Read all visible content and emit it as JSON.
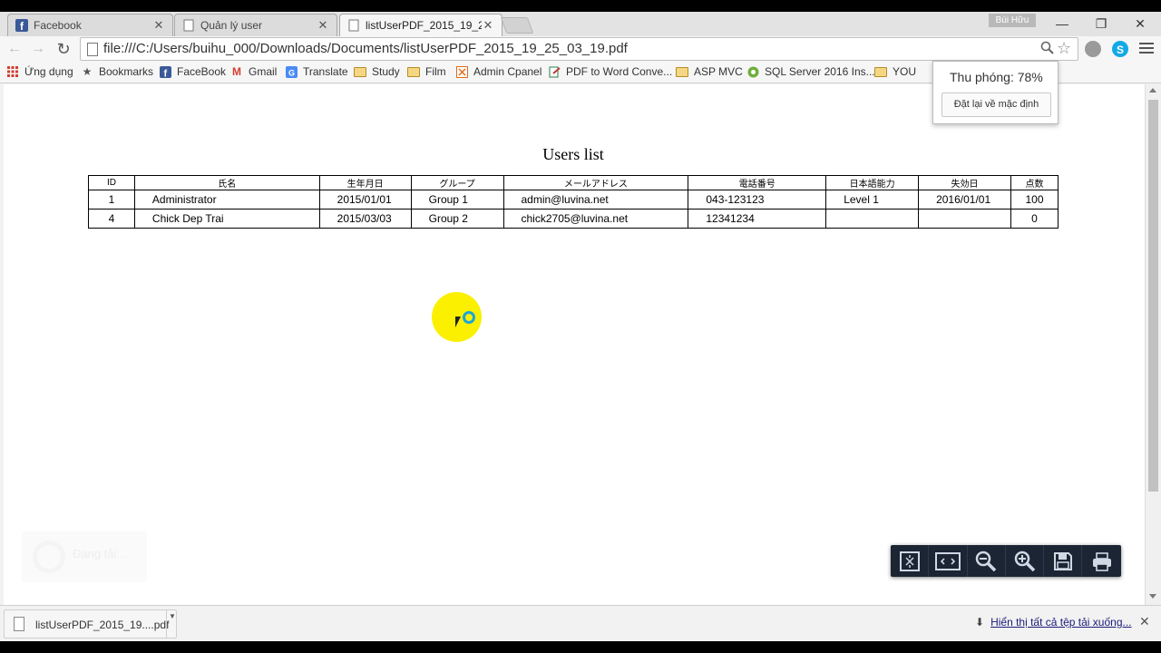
{
  "tabs": [
    {
      "title": "Facebook",
      "favicon": "facebook-icon"
    },
    {
      "title": "Quản lý user",
      "favicon": "page-icon"
    },
    {
      "title": "listUserPDF_2015_19_25_0",
      "favicon": "page-icon",
      "active": true
    }
  ],
  "profile_name": "Bùi Hữu",
  "window_controls": {
    "minimize": "—",
    "restore": "❐",
    "close": "✕"
  },
  "address_bar": {
    "url": "file:///C:/Users/buihu_000/Downloads/Documents/listUserPDF_2015_19_25_03_19.pdf"
  },
  "bookmarks": [
    {
      "label": "Ứng dụng",
      "icon": "apps-grid-icon"
    },
    {
      "label": "Bookmarks",
      "icon": "star-icon"
    },
    {
      "label": "FaceBook",
      "icon": "facebook-icon"
    },
    {
      "label": "Gmail",
      "icon": "gmail-icon"
    },
    {
      "label": "Translate",
      "icon": "translate-icon"
    },
    {
      "label": "Study",
      "icon": "folder-icon"
    },
    {
      "label": "Film",
      "icon": "folder-icon"
    },
    {
      "label": "Admin Cpanel",
      "icon": "cpanel-icon"
    },
    {
      "label": "PDF to Word Conve...",
      "icon": "pdf-convert-icon"
    },
    {
      "label": "ASP MVC",
      "icon": "folder-icon"
    },
    {
      "label": "SQL Server 2016 Ins...",
      "icon": "sqlserver-icon"
    },
    {
      "label": "YOU",
      "icon": "folder-icon"
    }
  ],
  "zoom_popup": {
    "label": "Thu phóng: 78%",
    "reset_label": "Đặt lại về mặc định"
  },
  "document": {
    "title": "Users list",
    "columns": [
      "ID",
      "氏名",
      "生年月日",
      "グループ",
      "メールアドレス",
      "電話番号",
      "日本語能力",
      "失効日",
      "点数"
    ],
    "rows": [
      [
        "1",
        "Administrator",
        "2015/01/01",
        "Group 1",
        "admin@luvina.net",
        "043-123123",
        "Level 1",
        "2016/01/01",
        "100"
      ],
      [
        "4",
        "Chick Dep Trai",
        "2015/03/03",
        "Group 2",
        "chick2705@luvina.net",
        "12341234",
        "",
        "",
        "0"
      ]
    ]
  },
  "loading_overlay": {
    "label": "Đang tải..."
  },
  "pdf_toolbar": [
    "fit-page-icon",
    "fit-width-icon",
    "zoom-out-icon",
    "zoom-in-icon",
    "save-icon",
    "print-icon"
  ],
  "download_shelf": {
    "filename": "listUserPDF_2015_19....pdf",
    "show_all": "Hiển thị tất cả tệp tải xuống..."
  },
  "colors": {
    "cursor_highlight": "#fbf000",
    "pdf_toolbar_bg": "#1c2533",
    "link": "#1a1a7a"
  }
}
